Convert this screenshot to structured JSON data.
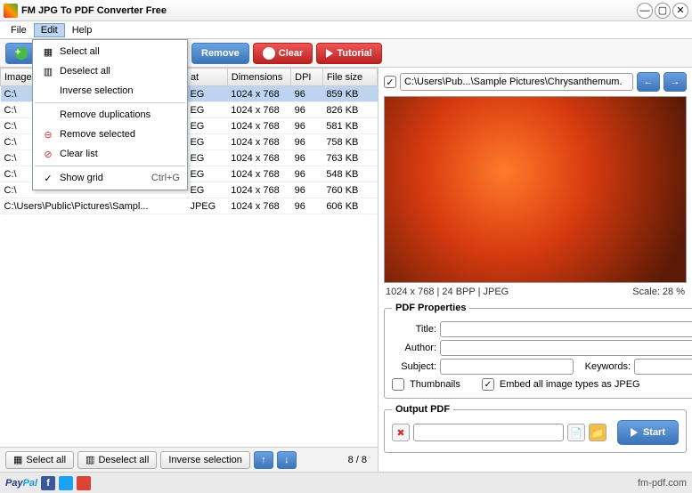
{
  "window": {
    "title": "FM JPG To PDF Converter Free"
  },
  "menubar": {
    "file": "File",
    "edit": "Edit",
    "help": "Help"
  },
  "toolbar": {
    "remove": "Remove",
    "clear": "Clear",
    "tutorial": "Tutorial"
  },
  "editmenu": {
    "select_all": "Select all",
    "deselect_all": "Deselect all",
    "inverse": "Inverse selection",
    "remove_dup": "Remove duplications",
    "remove_sel": "Remove selected",
    "clear_list": "Clear list",
    "show_grid": "Show grid",
    "show_grid_short": "Ctrl+G"
  },
  "columns": {
    "image": "Image",
    "format": "at",
    "dimensions": "Dimensions",
    "dpi": "DPI",
    "filesize": "File size"
  },
  "rows": [
    {
      "img": "C:\\",
      "fmt": "EG",
      "dim": "1024 x 768",
      "dpi": "96",
      "size": "859 KB",
      "sel": true
    },
    {
      "img": "C:\\",
      "fmt": "EG",
      "dim": "1024 x 768",
      "dpi": "96",
      "size": "826 KB"
    },
    {
      "img": "C:\\",
      "fmt": "EG",
      "dim": "1024 x 768",
      "dpi": "96",
      "size": "581 KB"
    },
    {
      "img": "C:\\",
      "fmt": "EG",
      "dim": "1024 x 768",
      "dpi": "96",
      "size": "758 KB"
    },
    {
      "img": "C:\\",
      "fmt": "EG",
      "dim": "1024 x 768",
      "dpi": "96",
      "size": "763 KB"
    },
    {
      "img": "C:\\",
      "fmt": "EG",
      "dim": "1024 x 768",
      "dpi": "96",
      "size": "548 KB"
    },
    {
      "img": "C:\\",
      "fmt": "EG",
      "dim": "1024 x 768",
      "dpi": "96",
      "size": "760 KB"
    },
    {
      "img": "C:\\Users\\Public\\Pictures\\Sampl...",
      "fmt": "JPEG",
      "dim": "1024 x 768",
      "dpi": "96",
      "size": "606 KB"
    }
  ],
  "preview": {
    "path": "C:\\Users\\Pub...\\Sample Pictures\\Chrysanthemum.",
    "info": "1024 x 768  |  24 BPP  |  JPEG",
    "scale": "Scale: 28 %"
  },
  "pdf": {
    "legend": "PDF Properties",
    "title_lbl": "Title:",
    "author_lbl": "Author:",
    "subject_lbl": "Subject:",
    "keywords_lbl": "Keywords:",
    "thumbnails": "Thumbnails",
    "embed": "Embed all image types as JPEG"
  },
  "output": {
    "legend": "Output PDF",
    "start": "Start"
  },
  "bottom": {
    "select_all": "Select all",
    "deselect_all": "Deselect all",
    "inverse": "Inverse selection",
    "count": "8 / 8"
  },
  "footer": {
    "link": "fm-pdf.com"
  }
}
